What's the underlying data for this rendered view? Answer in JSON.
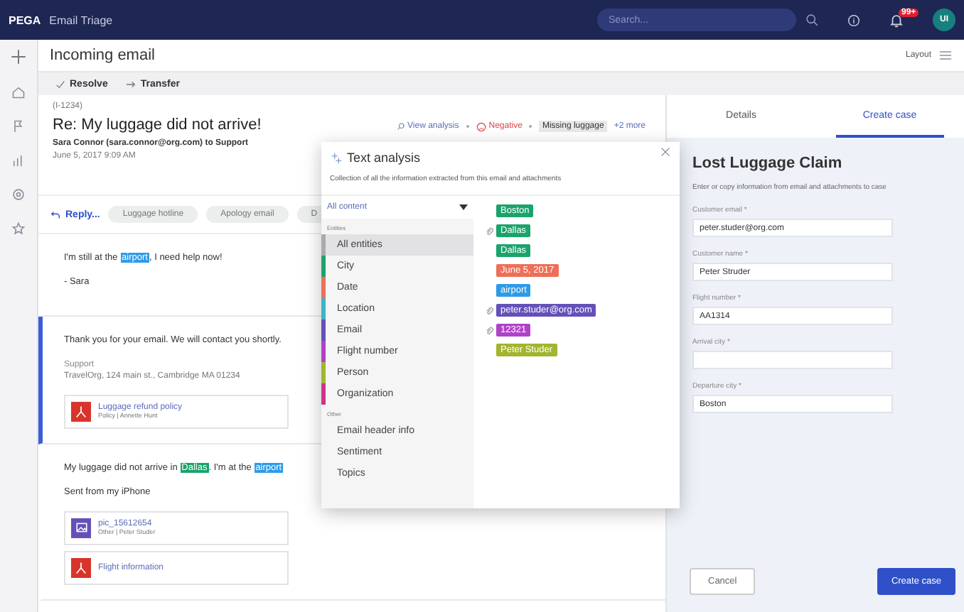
{
  "topbar": {
    "brand": "PEGA",
    "app": "Email Triage",
    "search": {
      "placeholder": "Search..."
    },
    "badge": "99+",
    "avatar": "UI"
  },
  "header": {
    "title": "Incoming email",
    "layout": "Layout"
  },
  "actions": [
    "Resolve",
    "Transfer"
  ],
  "email": {
    "id": "(I-1234)",
    "subject": "Re: My luggage did not arrive!",
    "from": "Sara Connor (sara.connor@org.com) to Support",
    "date": "June 5, 2017 9:09 AM",
    "analysis": {
      "view": "View analysis",
      "sentiment": "Negative",
      "topic": "Missing luggage",
      "more": "+2 more"
    },
    "reply": "Reply...",
    "chips": [
      "Luggage hotline",
      "Apology email",
      "D"
    ],
    "messages": [
      {
        "outgoing": false,
        "paragraphs": [
          [
            {
              "text": "I'm still at the "
            },
            {
              "text": "airport",
              "color": "#2d9be8"
            },
            {
              "text": ", I need help now!"
            }
          ],
          [
            {
              "text": "- Sara"
            }
          ]
        ]
      },
      {
        "outgoing": true,
        "paragraphs": [
          [
            {
              "text": "Thank you for your email. We will contact you shortly."
            }
          ]
        ],
        "signature": [
          "Support",
          "TravelOrg, 124 main st., Cambridge MA 01234"
        ],
        "attachments": [
          {
            "kind": "pdf",
            "name": "Luggage refund policy",
            "meta": "Policy | Annette Hunt"
          }
        ]
      },
      {
        "outgoing": false,
        "paragraphs": [
          [
            {
              "text": "My luggage did not arrive in "
            },
            {
              "text": "Dallas",
              "color": "#1aa36b"
            },
            {
              "text": ". I'm at the "
            },
            {
              "text": "airport",
              "color": "#2d9be8"
            }
          ],
          [
            {
              "text": "Sent from my iPhone"
            }
          ]
        ],
        "attachments": [
          {
            "kind": "image",
            "name": "pic_15612654",
            "meta": "Other | Peter Studer"
          },
          {
            "kind": "pdf",
            "name": "Flight information"
          }
        ]
      }
    ]
  },
  "analysis": {
    "title": "Text analysis",
    "description": "Collection of all the information extracted from this email and attachments",
    "filter": "All content",
    "groups": [
      {
        "label": "Entities",
        "items": [
          {
            "label": "All entities",
            "selected": true
          },
          {
            "label": "City",
            "color": "#1aa36b",
            "selected": false
          },
          {
            "label": "Date",
            "color": "#ee6f57",
            "selected": false
          },
          {
            "label": "Location",
            "color": "#3bb5c4",
            "selected": false
          },
          {
            "label": "Email",
            "color": "#6650b8",
            "selected": false
          },
          {
            "label": "Flight number",
            "color": "#b042c8",
            "selected": false
          },
          {
            "label": "Person",
            "color": "#a3b52e",
            "selected": false
          },
          {
            "label": "Organization",
            "color": "#d0328c",
            "selected": false
          }
        ]
      },
      {
        "label": "Other",
        "items": [
          {
            "label": "Email header info",
            "selected": false
          },
          {
            "label": "Sentiment",
            "selected": false
          },
          {
            "label": "Topics",
            "selected": false
          }
        ]
      }
    ],
    "tags": [
      {
        "text": "Boston",
        "color": "#1aa36b",
        "attached": false
      },
      {
        "text": "Dallas",
        "color": "#1aa36b",
        "attached": true
      },
      {
        "text": "Dallas",
        "color": "#1aa36b",
        "attached": false
      },
      {
        "text": "June 5, 2017",
        "color": "#ee6f57",
        "attached": false
      },
      {
        "text": "airport",
        "color": "#2d9be8",
        "attached": false
      },
      {
        "text": "peter.studer@org.com",
        "color": "#6650b8",
        "attached": true
      },
      {
        "text": "12321",
        "color": "#b042c8",
        "attached": true
      },
      {
        "text": "Peter Studer",
        "color": "#a3b52e",
        "attached": false
      }
    ]
  },
  "panel": {
    "tabs": [
      {
        "label": "Details",
        "selected": false
      },
      {
        "label": "Create case",
        "selected": true
      }
    ],
    "title": "Lost Luggage Claim",
    "description": "Enter or copy information from email and attachments to case",
    "fields": [
      {
        "label": "Customer email *",
        "value": "peter.studer@org.com"
      },
      {
        "label": "Customer name *",
        "value": "Peter Struder"
      },
      {
        "label": "Flight number *",
        "value": "AA1314"
      },
      {
        "label": "Arrival city *"
      },
      {
        "label": "Departure city *",
        "value": "Boston"
      }
    ],
    "buttons": [
      "Cancel",
      "Create case"
    ]
  }
}
